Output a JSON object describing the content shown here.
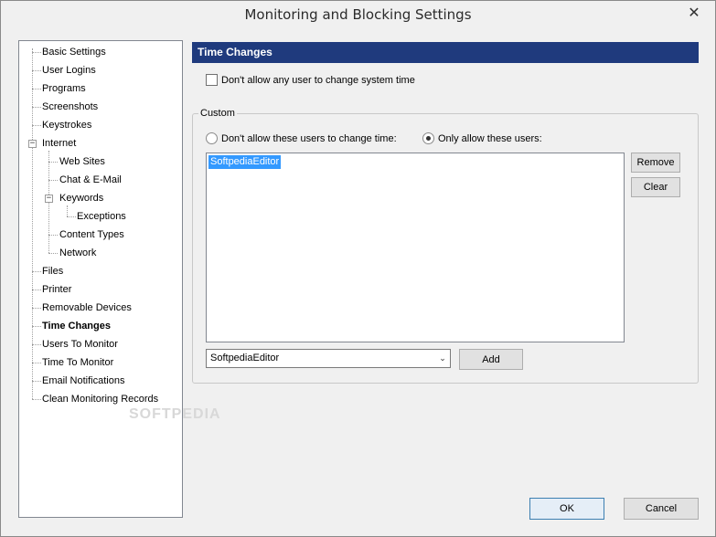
{
  "window": {
    "title": "Monitoring and Blocking Settings",
    "close_glyph": "✕"
  },
  "tree": {
    "items": [
      {
        "label": "Basic Settings"
      },
      {
        "label": "User Logins"
      },
      {
        "label": "Programs"
      },
      {
        "label": "Screenshots"
      },
      {
        "label": "Keystrokes"
      },
      {
        "label": "Internet",
        "expanded": true
      },
      {
        "label": "Web Sites"
      },
      {
        "label": "Chat & E-Mail"
      },
      {
        "label": "Keywords",
        "expanded": true
      },
      {
        "label": "Exceptions"
      },
      {
        "label": "Content Types"
      },
      {
        "label": "Network"
      },
      {
        "label": "Files"
      },
      {
        "label": "Printer"
      },
      {
        "label": "Removable Devices"
      },
      {
        "label": "Time Changes",
        "selected": true
      },
      {
        "label": "Users To Monitor"
      },
      {
        "label": "Time To Monitor"
      },
      {
        "label": "Email Notifications"
      },
      {
        "label": "Clean Monitoring Records"
      }
    ],
    "expander_glyph": "−",
    "watermark": "SOFTPEDIA"
  },
  "panel": {
    "header": "Time Changes",
    "no_change_checkbox_label": "Don't allow any user to change system time",
    "no_change_checked": false,
    "custom_group_title": "Custom",
    "radio_deny_label": "Don't allow these users to change time:",
    "radio_allow_label": "Only allow these users:",
    "selected_mode": "allow",
    "users_list": [
      "SoftpediaEditor"
    ],
    "remove_button": "Remove",
    "clear_button": "Clear",
    "user_combo_value": "SoftpediaEditor",
    "combo_arrow_glyph": "⌄",
    "add_button": "Add"
  },
  "footer": {
    "ok_button": "OK",
    "cancel_button": "Cancel"
  },
  "colors": {
    "header_bg": "#1f3a7d",
    "selection_bg": "#3399ff"
  }
}
